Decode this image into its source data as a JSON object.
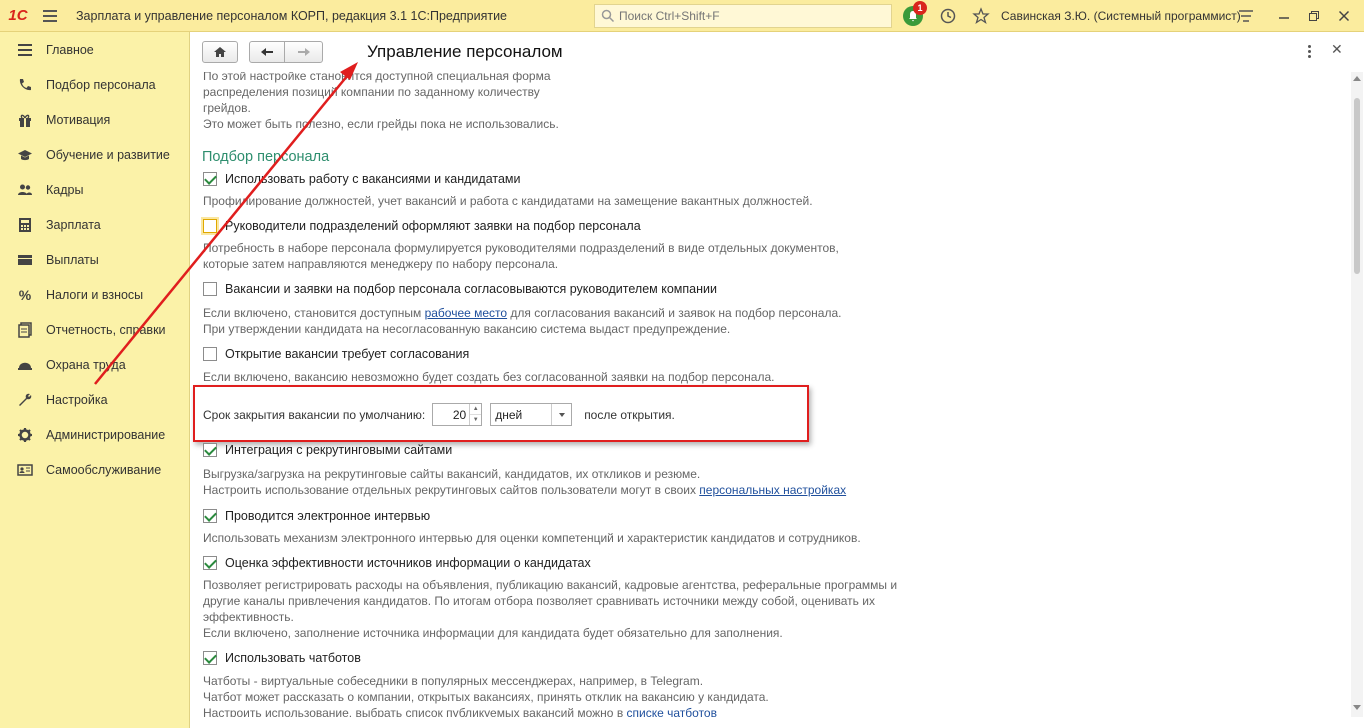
{
  "titlebar": {
    "logo": "1С",
    "app_title": "Зарплата и управление персоналом КОРП, редакция 3.1 1С:Предприятие",
    "search_placeholder": "Поиск Ctrl+Shift+F",
    "notification_count": "1",
    "user": "Савинская З.Ю. (Системный программист)"
  },
  "sidebar": {
    "items": [
      {
        "label": "Главное",
        "icon": "menu-lines-icon"
      },
      {
        "label": "Подбор персонала",
        "icon": "phone-icon"
      },
      {
        "label": "Мотивация",
        "icon": "gift-icon"
      },
      {
        "label": "Обучение и развитие",
        "icon": "graduation-cap-icon"
      },
      {
        "label": "Кадры",
        "icon": "people-icon"
      },
      {
        "label": "Зарплата",
        "icon": "calculator-icon"
      },
      {
        "label": "Выплаты",
        "icon": "wallet-icon"
      },
      {
        "label": "Налоги и взносы",
        "icon": "percent-icon"
      },
      {
        "label": "Отчетность, справки",
        "icon": "report-icon"
      },
      {
        "label": "Охрана труда",
        "icon": "helmet-icon"
      },
      {
        "label": "Настройка",
        "icon": "wrench-icon"
      },
      {
        "label": "Администрирование",
        "icon": "gear-icon"
      },
      {
        "label": "Самообслуживание",
        "icon": "id-card-icon"
      }
    ]
  },
  "main": {
    "title": "Управление персоналом",
    "intro_lines": [
      "По этой настройке становится доступной специальная форма",
      "распределения позиций компании по заданному количеству",
      "грейдов.",
      "Это может быть полезно, если грейды пока не использовались."
    ],
    "section_title": "Подбор персонала",
    "options": [
      {
        "label": "Использовать работу с вакансиями и кандидатами",
        "checked": true,
        "desc": [
          "Профилирование должностей, учет вакансий и работа с кандидатами на замещение вакантных должностей."
        ]
      },
      {
        "label": "Руководители подразделений оформляют заявки на подбор персонала",
        "checked": false,
        "desc": [
          "Потребность в наборе персонала формулируется руководителями подразделений в виде отдельных документов,",
          "которые затем направляются менеджеру по набору персонала."
        ]
      },
      {
        "label": "Вакансии и заявки на подбор персонала согласовываются руководителем компании",
        "checked": false,
        "desc_prefix": "Если включено, становится доступным ",
        "desc_link": "рабочее место",
        "desc_suffix": " для согласования вакансий и заявок на подбор персонала.",
        "desc2": "При утверждении кандидата на несогласованную вакансию система выдаст предупреждение."
      },
      {
        "label": "Открытие вакансии требует согласования",
        "checked": false,
        "desc": [
          "Если включено, вакансию невозможно будет создать без согласованной заявки на подбор персонала."
        ]
      },
      {
        "label": "Интеграция с рекрутинговыми сайтами",
        "checked": true,
        "desc": [
          "Выгрузка/загрузка на рекрутинговые сайты вакансий, кандидатов, их откликов и резюме."
        ],
        "desc2_prefix": "Настроить использование отдельных рекрутинговых сайтов пользователи могут в своих ",
        "desc2_link": "персональных настройках"
      },
      {
        "label": "Проводится электронное интервью",
        "checked": true,
        "desc": [
          "Использовать механизм электронного интервью для оценки компетенций и характеристик кандидатов и сотрудников."
        ]
      },
      {
        "label": "Оценка эффективности источников информации о кандидатах",
        "checked": true,
        "desc": [
          "Позволяет регистрировать расходы на объявления, публикацию вакансий, кадровые агентства, реферальные программы и",
          "другие каналы привлечения кандидатов. По итогам отбора позволяет сравнивать источники между собой, оценивать их",
          "эффективность.",
          "Если включено, заполнение источника информации для кандидата будет обязательно для заполнения."
        ]
      },
      {
        "label": "Использовать чатботов",
        "checked": true,
        "desc": [
          "Чатботы - виртуальные собеседники в популярных мессенджерах, например, в Telegram.",
          "Чатбот может рассказать о компании, открытых вакансиях, принять отклик на вакансию у кандидата."
        ],
        "desc3_prefix": "Настроить использование, выбрать список публикуемых вакансий можно в ",
        "desc3_link": "списке чатботов"
      }
    ],
    "term": {
      "label": "Срок закрытия вакансии по умолчанию:",
      "value": "20",
      "unit": "дней",
      "after": "после открытия."
    }
  },
  "colors": {
    "titlebar_bg": "#fbec9e",
    "sidebar_bg": "#fbf2a8",
    "section_title": "#2e8e6e",
    "highlight_red": "#e01e1e",
    "check_green": "#2b8a3e"
  }
}
